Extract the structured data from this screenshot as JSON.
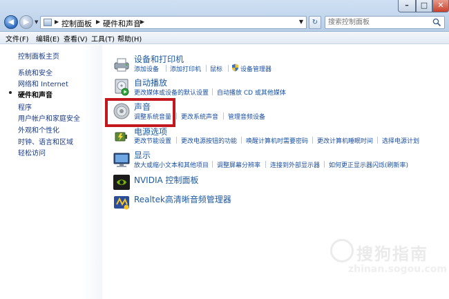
{
  "window": {
    "controls": {
      "minimize": "–",
      "maximize": "□",
      "close": "✕"
    }
  },
  "addressbar": {
    "crumbs": [
      "控制面板",
      "硬件和声音"
    ]
  },
  "search": {
    "placeholder": "搜索控制面板"
  },
  "menubar": {
    "items": [
      "文件(F)",
      "编辑(E)",
      "查看(V)",
      "工具(T)",
      "帮助(H)"
    ]
  },
  "sidebar": {
    "items": [
      {
        "label": "控制面板主页"
      },
      {
        "label": "系统和安全"
      },
      {
        "label": "网络和 Internet"
      },
      {
        "label": "硬件和声音",
        "active": true
      },
      {
        "label": "程序"
      },
      {
        "label": "用户帐户和家庭安全"
      },
      {
        "label": "外观和个性化"
      },
      {
        "label": "时钟、语言和区域"
      },
      {
        "label": "轻松访问"
      }
    ]
  },
  "main": {
    "categories": [
      {
        "title": "设备和打印机",
        "icon": "printer-icon",
        "links": [
          "添加设备",
          "添加打印机",
          "鼠标",
          "设备管理器"
        ]
      },
      {
        "title": "自动播放",
        "icon": "autoplay-icon",
        "links": [
          "更改媒体或设备的默认设置",
          "自动播放 CD 或其他媒体"
        ]
      },
      {
        "title": "声音",
        "icon": "speaker-icon",
        "links": [
          "调整系统音量",
          "更改系统声音",
          "管理音频设备"
        ]
      },
      {
        "title": "电源选项",
        "icon": "power-icon",
        "links": [
          "更改节能设置",
          "更改电源按钮的功能",
          "唤醒计算机时需要密码",
          "更改计算机睡眠时间",
          "选择电源计划"
        ]
      },
      {
        "title": "显示",
        "icon": "display-icon",
        "links": [
          "放大或缩小文本和其他项目",
          "调整屏幕分辨率",
          "连接到外部显示器",
          "如何更正显示器闪烁(刷新率)"
        ]
      },
      {
        "title": "NVIDIA 控制面板",
        "icon": "nvidia-icon",
        "links": []
      },
      {
        "title": "Realtek高清晰音频管理器",
        "icon": "realtek-icon",
        "links": []
      }
    ]
  },
  "watermark": {
    "text": "搜狗指南",
    "url": "zhinan.sogou.com"
  },
  "colors": {
    "link": "#1a4fa0",
    "title": "#1e5aa0",
    "highlight": "#c2171d"
  }
}
